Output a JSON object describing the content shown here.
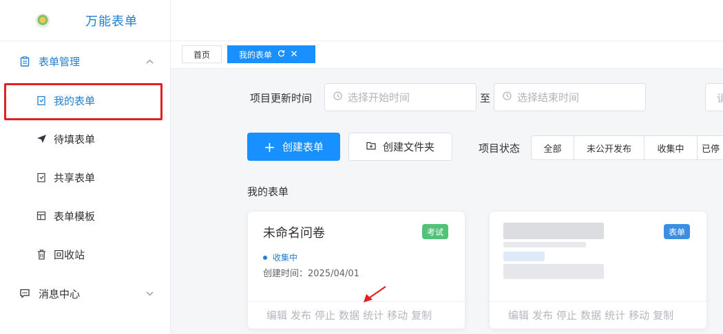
{
  "brand": {
    "title": "万能表单"
  },
  "sidebar": {
    "group_forms": {
      "label": "表单管理",
      "icon": "form-icon"
    },
    "items": [
      {
        "label": "我的表单",
        "icon": "form-doc-icon"
      },
      {
        "label": "待填表单",
        "icon": "send-icon"
      },
      {
        "label": "共享表单",
        "icon": "share-doc-icon"
      },
      {
        "label": "表单模板",
        "icon": "template-icon"
      },
      {
        "label": "回收站",
        "icon": "trash-icon"
      }
    ],
    "group_messages": {
      "label": "消息中心",
      "icon": "message-icon"
    }
  },
  "tabs": {
    "home": "首页",
    "current": "我的表单"
  },
  "filter": {
    "label": "项目更新时间",
    "start_placeholder": "选择开始时间",
    "to": "至",
    "end_placeholder": "选择结束时间",
    "cut_text": "请"
  },
  "actions": {
    "create": "创建表单",
    "folder": "创建文件夹"
  },
  "status_filter": {
    "label": "项目状态",
    "options": [
      "全部",
      "未公开发布",
      "收集中",
      "已停"
    ]
  },
  "section_title": "我的表单",
  "cards": [
    {
      "title": "未命名问卷",
      "badge": "考试",
      "status": "收集中",
      "created": "创建时间：2025/04/01",
      "actions": [
        "编辑",
        "发布",
        "停止",
        "数据",
        "统计",
        "移动",
        "复制"
      ]
    },
    {
      "badge": "表单",
      "actions": [
        "编辑",
        "发布",
        "停止",
        "数据",
        "统计",
        "移动",
        "复制"
      ]
    }
  ],
  "colors": {
    "primary": "#1890ff",
    "accent_text": "#1f7ed6",
    "exam_badge": "#52c279",
    "form_badge": "#3d8ee0",
    "highlight": "#e02020"
  }
}
